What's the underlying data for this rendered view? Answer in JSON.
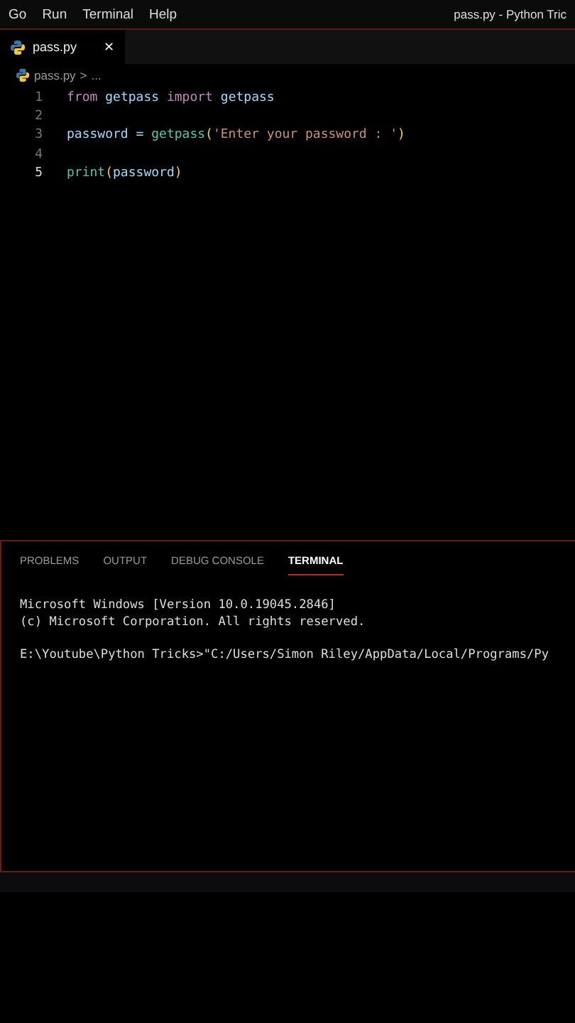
{
  "menu_bar": {
    "items": [
      "Go",
      "Run",
      "Terminal",
      "Help"
    ],
    "window_title": "pass.py - Python Tric"
  },
  "editor_tabs": [
    {
      "label": "pass.py",
      "close": "✕",
      "selected": true
    }
  ],
  "breadcrumb": {
    "file": "pass.py",
    "separator": ">",
    "rest": "..."
  },
  "code_lines": [
    {
      "number": "1",
      "current": false,
      "tokens": [
        {
          "kind": "keyword",
          "text": "from"
        },
        {
          "kind": "text",
          "text": " getpass "
        },
        {
          "kind": "keyword",
          "text": "import"
        },
        {
          "kind": "text",
          "text": " getpass"
        }
      ]
    },
    {
      "number": "2",
      "current": false
    },
    {
      "number": "3",
      "current": false,
      "tokens": [
        {
          "kind": "text",
          "text": "password = "
        },
        {
          "kind": "func",
          "text": "getpass"
        },
        {
          "kind": "bracket",
          "text": "("
        },
        {
          "kind": "string",
          "text": "'Enter your password : '"
        },
        {
          "kind": "bracket",
          "text": ")"
        }
      ]
    },
    {
      "number": "4",
      "current": false
    },
    {
      "number": "5",
      "current": true,
      "tokens": [
        {
          "kind": "func",
          "text": "print"
        },
        {
          "kind": "bracket",
          "text": "("
        },
        {
          "kind": "text",
          "text": "password"
        },
        {
          "kind": "bracket",
          "text": ")"
        }
      ]
    }
  ],
  "panel_tabs": [
    {
      "label": "PROBLEMS",
      "selected": false
    },
    {
      "label": "OUTPUT",
      "selected": false
    },
    {
      "label": "DEBUG CONSOLE",
      "selected": false
    },
    {
      "label": "TERMINAL",
      "selected": true
    }
  ],
  "terminal_blocks": [
    {
      "lines": [
        "Microsoft Windows [Version 10.0.19045.2846]",
        "(c) Microsoft Corporation. All rights reserved."
      ]
    },
    {
      "lines": [
        "E:\\Youtube\\Python Tricks>\"C:/Users/Simon Riley/AppData/Local/Programs/Py"
      ]
    }
  ]
}
